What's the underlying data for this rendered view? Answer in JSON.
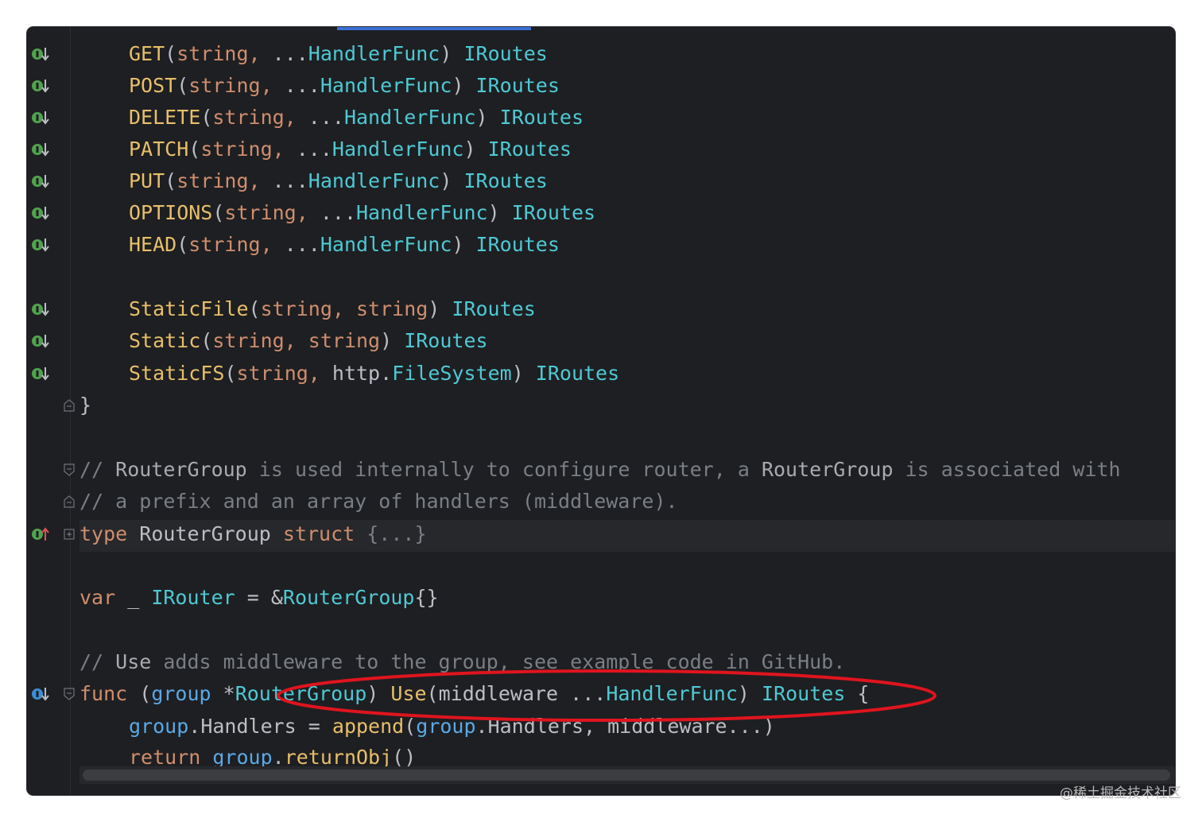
{
  "editor": {
    "lines": [
      {
        "id": "get",
        "segs": [
          [
            "fn",
            "GET"
          ],
          [
            "pu",
            "("
          ],
          [
            "kw",
            "string, "
          ],
          [
            "pu",
            "..."
          ],
          [
            "ty",
            "HandlerFunc"
          ],
          [
            "pu",
            ") "
          ],
          [
            "ty",
            "IRoutes"
          ]
        ]
      },
      {
        "id": "post",
        "segs": [
          [
            "fn",
            "POST"
          ],
          [
            "pu",
            "("
          ],
          [
            "kw",
            "string, "
          ],
          [
            "pu",
            "..."
          ],
          [
            "ty",
            "HandlerFunc"
          ],
          [
            "pu",
            ") "
          ],
          [
            "ty",
            "IRoutes"
          ]
        ]
      },
      {
        "id": "delete",
        "segs": [
          [
            "fn",
            "DELETE"
          ],
          [
            "pu",
            "("
          ],
          [
            "kw",
            "string, "
          ],
          [
            "pu",
            "..."
          ],
          [
            "ty",
            "HandlerFunc"
          ],
          [
            "pu",
            ") "
          ],
          [
            "ty",
            "IRoutes"
          ]
        ]
      },
      {
        "id": "patch",
        "segs": [
          [
            "fn",
            "PATCH"
          ],
          [
            "pu",
            "("
          ],
          [
            "kw",
            "string, "
          ],
          [
            "pu",
            "..."
          ],
          [
            "ty",
            "HandlerFunc"
          ],
          [
            "pu",
            ") "
          ],
          [
            "ty",
            "IRoutes"
          ]
        ]
      },
      {
        "id": "put",
        "segs": [
          [
            "fn",
            "PUT"
          ],
          [
            "pu",
            "("
          ],
          [
            "kw",
            "string, "
          ],
          [
            "pu",
            "..."
          ],
          [
            "ty",
            "HandlerFunc"
          ],
          [
            "pu",
            ") "
          ],
          [
            "ty",
            "IRoutes"
          ]
        ]
      },
      {
        "id": "options",
        "segs": [
          [
            "fn",
            "OPTIONS"
          ],
          [
            "pu",
            "("
          ],
          [
            "kw",
            "string, "
          ],
          [
            "pu",
            "..."
          ],
          [
            "ty",
            "HandlerFunc"
          ],
          [
            "pu",
            ") "
          ],
          [
            "ty",
            "IRoutes"
          ]
        ]
      },
      {
        "id": "head",
        "segs": [
          [
            "fn",
            "HEAD"
          ],
          [
            "pu",
            "("
          ],
          [
            "kw",
            "string, "
          ],
          [
            "pu",
            "..."
          ],
          [
            "ty",
            "HandlerFunc"
          ],
          [
            "pu",
            ") "
          ],
          [
            "ty",
            "IRoutes"
          ]
        ]
      },
      {
        "id": "staticfile",
        "segs": [
          [
            "fn",
            "StaticFile"
          ],
          [
            "pu",
            "("
          ],
          [
            "kw",
            "string, string"
          ],
          [
            "pu",
            ") "
          ],
          [
            "ty",
            "IRoutes"
          ]
        ]
      },
      {
        "id": "static",
        "segs": [
          [
            "fn",
            "Static"
          ],
          [
            "pu",
            "("
          ],
          [
            "kw",
            "string, string"
          ],
          [
            "pu",
            ") "
          ],
          [
            "ty",
            "IRoutes"
          ]
        ]
      },
      {
        "id": "staticfs",
        "segs": [
          [
            "fn",
            "StaticFS"
          ],
          [
            "pu",
            "("
          ],
          [
            "kw",
            "string, "
          ],
          [
            "pk",
            "http."
          ],
          [
            "ty",
            "FileSystem"
          ],
          [
            "pu",
            ") "
          ],
          [
            "ty",
            "IRoutes"
          ]
        ]
      },
      {
        "id": "close-brace",
        "segs": [
          [
            "pu",
            "}"
          ]
        ]
      },
      {
        "id": "comment1",
        "segs": [
          [
            "cm",
            "// "
          ],
          [
            "cmt-txt",
            "RouterGroup"
          ],
          [
            "cm",
            " is used internally to configure router, a "
          ],
          [
            "cmt-txt",
            "RouterGroup"
          ],
          [
            "cm",
            " is associated with"
          ]
        ]
      },
      {
        "id": "comment2",
        "segs": [
          [
            "cm",
            "// a prefix and an array of handlers (middleware)."
          ]
        ]
      },
      {
        "id": "type-decl",
        "segs": [
          [
            "kw",
            "type "
          ],
          [
            "pu",
            "RouterGroup "
          ],
          [
            "kw",
            "struct "
          ],
          [
            "cm",
            "{...}"
          ]
        ]
      },
      {
        "id": "var-decl",
        "segs": [
          [
            "kw",
            "var "
          ],
          [
            "pu",
            "_ "
          ],
          [
            "ty",
            "IRouter"
          ],
          [
            "pu",
            " = &"
          ],
          [
            "ty",
            "RouterGroup"
          ],
          [
            "pu",
            "{}"
          ]
        ]
      },
      {
        "id": "comment3",
        "segs": [
          [
            "cm",
            "// "
          ],
          [
            "cmt-txt",
            "Use"
          ],
          [
            "cm",
            " adds middleware to the group, see example code in GitHub."
          ]
        ]
      },
      {
        "id": "func-decl",
        "segs": [
          [
            "kw",
            "func "
          ],
          [
            "pu",
            "("
          ],
          [
            "gp",
            "group "
          ],
          [
            "pu",
            "*"
          ],
          [
            "ty",
            "RouterGroup"
          ],
          [
            "pu",
            ") "
          ],
          [
            "fn",
            "Use"
          ],
          [
            "pu",
            "(middleware ..."
          ],
          [
            "ty",
            "HandlerFunc"
          ],
          [
            "pu",
            ") "
          ],
          [
            "ty",
            "IRoutes"
          ],
          [
            "pu",
            " {"
          ]
        ]
      },
      {
        "id": "handlers-line",
        "segs": [
          [
            "gp",
            "group"
          ],
          [
            "pu",
            ".Handlers = "
          ],
          [
            "fn",
            "append"
          ],
          [
            "pu",
            "("
          ],
          [
            "gp",
            "group"
          ],
          [
            "pu",
            ".Handlers, middleware...)"
          ]
        ]
      },
      {
        "id": "return-line",
        "segs": [
          [
            "kw",
            "return "
          ],
          [
            "gp",
            "group"
          ],
          [
            "pu",
            "."
          ],
          [
            "fn",
            "returnObj"
          ],
          [
            "pu",
            "()"
          ]
        ]
      }
    ]
  },
  "colors": {
    "background": "#1e1f22",
    "keyword": "#cf8e6d",
    "function": "#e8bf6a",
    "type": "#4ec9d4",
    "comment": "#7a7e85",
    "annotation-oval": "#e0141e",
    "implement-icon": "#4fa34d",
    "override-icon": "#3b8fd6"
  },
  "watermark": "@稀土掘金技术社区"
}
